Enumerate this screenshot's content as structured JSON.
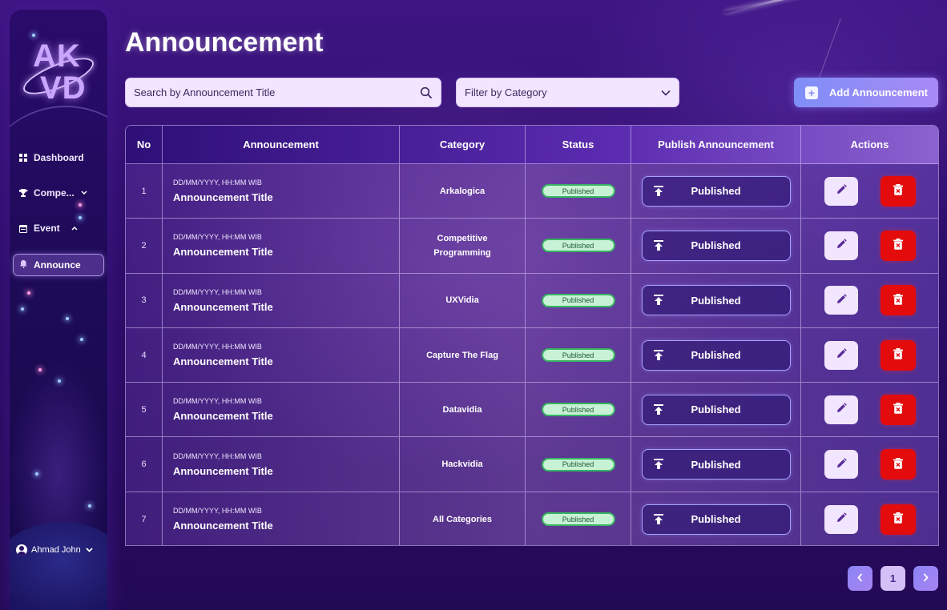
{
  "app": {
    "logo_line1": "AK",
    "logo_line2": "VD",
    "accent": "#7f8ef7",
    "danger": "#e30b0b",
    "success": "#37b461"
  },
  "sidebar": {
    "items": [
      {
        "label": "Dashboard",
        "icon": "grid-icon"
      },
      {
        "label": "Compe...",
        "icon": "trophy-icon",
        "chevron": "down"
      },
      {
        "label": "Event",
        "icon": "calendar-icon",
        "chevron": "up"
      },
      {
        "label": "Announce",
        "icon": "bell-icon",
        "active": true
      }
    ],
    "user": {
      "name": "Ahmad John",
      "icon": "user-circle-icon"
    }
  },
  "header": {
    "title": "Announcement",
    "search_placeholder": "Search by Announcement Title",
    "filter_label": "Filter by Category",
    "add_label": "Add Announcement"
  },
  "table": {
    "columns": [
      "No",
      "Announcement",
      "Category",
      "Status",
      "Publish Announcement",
      "Actions"
    ],
    "rows": [
      {
        "no": "1",
        "date": "DD/MM/YYYY, HH:MM WIB",
        "title": "Announcement Title",
        "category": "Arkalogica",
        "status": "Published",
        "publish": "Published"
      },
      {
        "no": "2",
        "date": "DD/MM/YYYY, HH:MM WIB",
        "title": "Announcement Title",
        "category": "Competitive Programming",
        "status": "Published",
        "publish": "Published"
      },
      {
        "no": "3",
        "date": "DD/MM/YYYY, HH:MM WIB",
        "title": "Announcement Title",
        "category": "UXVidia",
        "status": "Published",
        "publish": "Published"
      },
      {
        "no": "4",
        "date": "DD/MM/YYYY, HH:MM WIB",
        "title": "Announcement Title",
        "category": "Capture The Flag",
        "status": "Published",
        "publish": "Published"
      },
      {
        "no": "5",
        "date": "DD/MM/YYYY, HH:MM WIB",
        "title": "Announcement Title",
        "category": "Datavidia",
        "status": "Published",
        "publish": "Published"
      },
      {
        "no": "6",
        "date": "DD/MM/YYYY, HH:MM WIB",
        "title": "Announcement Title",
        "category": "Hackvidia",
        "status": "Published",
        "publish": "Published"
      },
      {
        "no": "7",
        "date": "DD/MM/YYYY, HH:MM WIB",
        "title": "Announcement Title",
        "category": "All Categories",
        "status": "Published",
        "publish": "Published"
      }
    ]
  },
  "pagination": {
    "prev": "‹",
    "current": "1",
    "next": "›"
  }
}
